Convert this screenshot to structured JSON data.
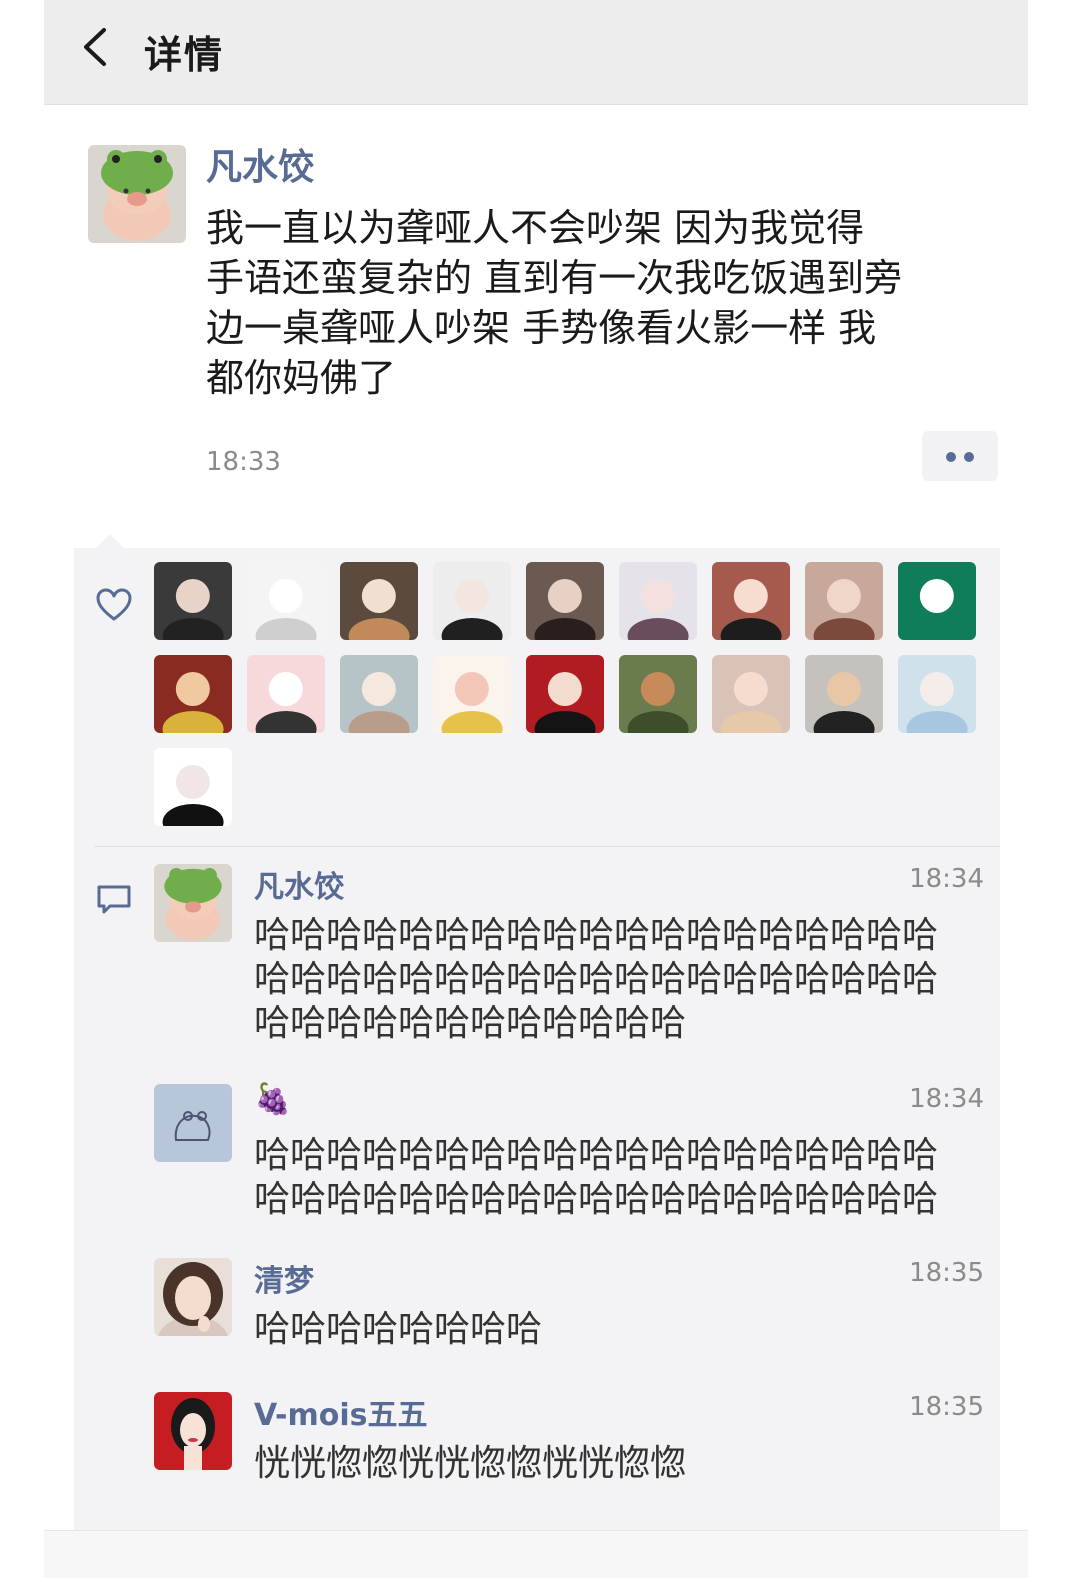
{
  "header": {
    "title": "详情",
    "back_icon": "chevron-left-icon"
  },
  "post": {
    "author": "凡水饺",
    "text": "我一直以为聋哑人不会吵架 因为我觉得\n手语还蛮复杂的 直到有一次我吃饭遇到旁\n边一桌聋哑人吵架 手势像看火影一样 我\n都你妈佛了",
    "time": "18:33"
  },
  "likes": {
    "icon": "heart-icon",
    "avatar_count": 19
  },
  "comments": {
    "icon": "comment-icon",
    "items": [
      {
        "name": "凡水饺",
        "time": "18:34",
        "text": "哈哈哈哈哈哈哈哈哈哈哈哈哈哈哈哈哈哈哈哈哈哈哈哈哈哈哈哈哈哈哈哈哈哈哈哈哈哈哈哈哈哈哈哈哈哈哈哈哈哈"
      },
      {
        "name": "🍇",
        "time": "18:34",
        "text": "哈哈哈哈哈哈哈哈哈哈哈哈哈哈哈哈哈哈哈哈哈哈哈哈哈哈哈哈哈哈哈哈哈哈哈哈哈哈"
      },
      {
        "name": "清梦",
        "time": "18:35",
        "text": "哈哈哈哈哈哈哈哈"
      },
      {
        "name": "V-mois五五",
        "time": "18:35",
        "text": "恍恍惚惚恍恍惚惚恍恍惚惚"
      }
    ]
  },
  "colors": {
    "link": "#576b95",
    "header_bg": "#ededed",
    "panel_bg": "#f3f3f5"
  }
}
